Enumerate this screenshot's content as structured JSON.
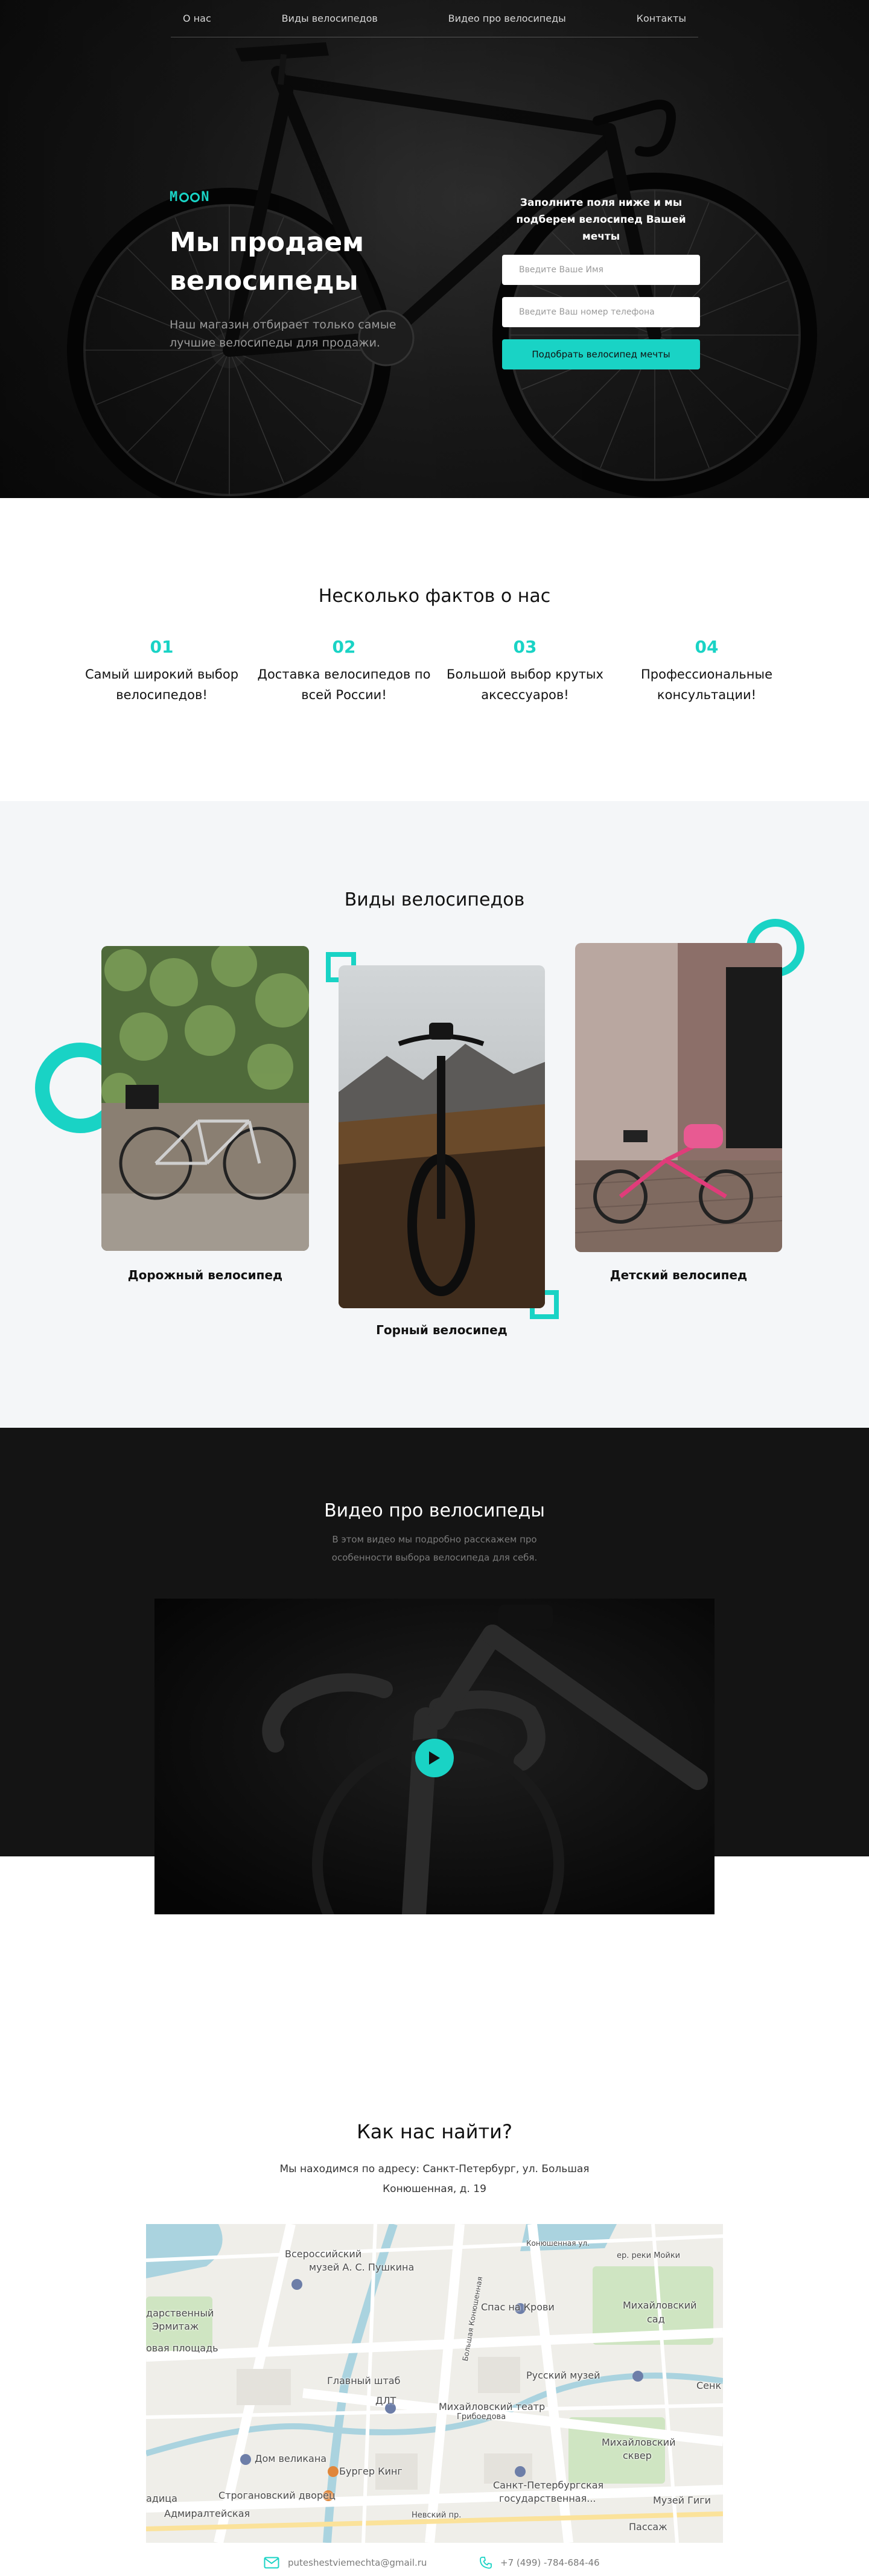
{
  "nav": {
    "items": [
      "О нас",
      "Виды велосипедов",
      "Видео про велосипеды",
      "Контакты"
    ]
  },
  "hero": {
    "logo": "MOON",
    "title": "Мы продаем велосипеды",
    "subtitle": "Наш магазин отбирает только самые лучшие велосипеды для продажи.",
    "form_title": "Заполните поля ниже и мы подберем велосипед Вашей мечты",
    "name_placeholder": "Введите Ваше Имя",
    "phone_placeholder": "Введите Ваш номер телефона",
    "submit_label": "Подобрать велосипед мечты"
  },
  "facts": {
    "title": "Несколько фактов о нас",
    "items": [
      {
        "num": "01",
        "text": "Самый широкий выбор велосипедов!"
      },
      {
        "num": "02",
        "text": "Доставка велосипедов по всей России!"
      },
      {
        "num": "03",
        "text": "Большой выбор крутых аксессуаров!"
      },
      {
        "num": "04",
        "text": "Профессиональные консультации!"
      }
    ]
  },
  "types": {
    "title": "Виды велосипедов",
    "cards": [
      {
        "label": "Дорожный велосипед"
      },
      {
        "label": "Горный велосипед"
      },
      {
        "label": "Детский велосипед"
      }
    ]
  },
  "video": {
    "title": "Видео про велосипеды",
    "subtitle": "В этом видео мы подробно расскажем про особенности выбора велосипеда для себя."
  },
  "find": {
    "title": "Как нас найти?",
    "address": "Мы находимся по адресу: Санкт-Петербург, ул. Большая Конюшенная, д. 19",
    "map_labels": [
      "Всероссийский",
      "музей А. С. Пушкина",
      "Конюшенная ул.",
      "ер. реки Мойки",
      "дарственный",
      "Эрмитаж",
      "Спас на Крови",
      "Михайловский",
      "сад",
      "овая площадь",
      "Главный штаб",
      "Русский музей",
      "ДЛТ",
      "Михайловский театр",
      "Дом великана",
      "Михайловский",
      "сквер",
      "Бургер Кинг",
      "Санкт-Петербургская",
      "государственная...",
      "Строгановский дворец",
      "Музей Гиги",
      "Адмиралтейская",
      "Невский пр.",
      "Пассаж",
      "адица",
      "Грибоедова",
      "Большая Конюшенная",
      "Сенк"
    ]
  },
  "contacts": {
    "email": "puteshestviemechta@gmail.ru",
    "phone": "+7 (499) -784-684-46"
  },
  "colors": {
    "accent": "#19d3c5",
    "dark": "#141414",
    "light_bg": "#f4f6f8"
  },
  "icons": [
    "mail-icon",
    "phone-icon",
    "play-icon"
  ]
}
